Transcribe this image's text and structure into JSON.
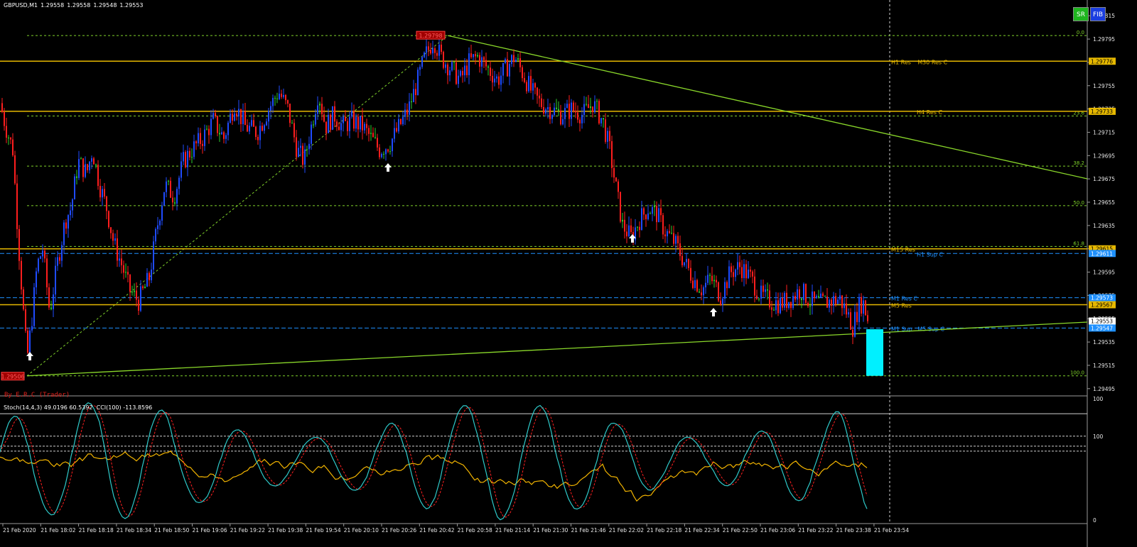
{
  "header": {
    "symbol": "GBPUSD,M1",
    "ohlc": [
      "1.29558",
      "1.29558",
      "1.29548",
      "1.29553"
    ]
  },
  "buttons": {
    "sr": "SR",
    "fib": "FIB"
  },
  "credit": "By E.R.C (Trader)",
  "indicator_label": "Stoch(14,4,3) 49.0196 60.5392  CCI(100) -113.8596",
  "colors": {
    "background": "#000000",
    "bull_candle": "#1f4bff",
    "bear_candle": "#ff1e1e",
    "neutral_candle": "#2ecc2e",
    "resistance": "#e6b800",
    "support": "#1e90ff",
    "fib": "#7fd22a",
    "trendline": "#8ad82a",
    "stoch_main": "#2ec9c9",
    "stoch_signal": "#ff2020",
    "cci": "#f2b400",
    "target_box": "#00f0ff"
  },
  "price_scale": [
    "1.29815",
    "1.29795",
    "1.29775",
    "1.29755",
    "1.29735",
    "1.29715",
    "1.29695",
    "1.29675",
    "1.29655",
    "1.29635",
    "1.29615",
    "1.29595",
    "1.29575",
    "1.29555",
    "1.29535",
    "1.29515",
    "1.29495"
  ],
  "price_tags": [
    {
      "price": 1.29776,
      "text": "1.29776",
      "color": "#e6b800",
      "text_color": "#000"
    },
    {
      "price": 1.29733,
      "text": "1.29733",
      "color": "#e6b800",
      "text_color": "#000"
    },
    {
      "price": 1.29615,
      "text": "1.29615",
      "color": "#e6b800",
      "text_color": "#000"
    },
    {
      "price": 1.29611,
      "text": "1.29611",
      "color": "#1e90ff",
      "text_color": "#fff"
    },
    {
      "price": 1.29573,
      "text": "1.29573",
      "color": "#1e90ff",
      "text_color": "#fff"
    },
    {
      "price": 1.29567,
      "text": "1.29567",
      "color": "#e6b800",
      "text_color": "#000"
    },
    {
      "price": 1.29553,
      "text": "1.29553",
      "color": "#ffffff",
      "text_color": "#000"
    },
    {
      "price": 1.29547,
      "text": "1.29547",
      "color": "#1e90ff",
      "text_color": "#fff"
    }
  ],
  "fib_levels": [
    {
      "price": 1.29798,
      "label": "0.0"
    },
    {
      "price": 1.29729,
      "label": "23.6"
    },
    {
      "price": 1.29686,
      "label": "38.2"
    },
    {
      "price": 1.29652,
      "label": "50.0"
    },
    {
      "price": 1.29617,
      "label": "61.8"
    },
    {
      "price": 1.29506,
      "label": "100.0"
    }
  ],
  "sr_lines": [
    {
      "price": 1.29776,
      "type": "res",
      "labels": [
        "H1 Res",
        "M30 Res C"
      ]
    },
    {
      "price": 1.29733,
      "type": "res",
      "labels": [
        "H4 Res C"
      ]
    },
    {
      "price": 1.29615,
      "type": "res",
      "labels": [
        "M15 Res"
      ]
    },
    {
      "price": 1.29611,
      "type": "sup",
      "labels": [
        "H1 Sup C"
      ]
    },
    {
      "price": 1.29573,
      "type": "sup",
      "labels": [
        "M1 Res C"
      ]
    },
    {
      "price": 1.29567,
      "type": "res",
      "labels": [
        "M5 Res"
      ]
    },
    {
      "price": 1.29547,
      "type": "sup",
      "labels": [
        "M1 Sup",
        "M5 Sup C"
      ]
    }
  ],
  "swing_labels": {
    "high": "1.29798",
    "low": "1.29506"
  },
  "arrow_icons": [
    "up-arrow-icon",
    "up-arrow-icon",
    "up-arrow-icon",
    "up-arrow-icon"
  ],
  "indicator_scale": [
    "100",
    "100",
    "0"
  ],
  "time_labels": [
    "21 Feb 2020",
    "21 Feb 18:02",
    "21 Feb 18:18",
    "21 Feb 18:34",
    "21 Feb 18:50",
    "21 Feb 19:06",
    "21 Feb 19:22",
    "21 Feb 19:38",
    "21 Feb 19:54",
    "21 Feb 20:10",
    "21 Feb 20:26",
    "21 Feb 20:42",
    "21 Feb 20:58",
    "21 Feb 21:14",
    "21 Feb 21:30",
    "21 Feb 21:46",
    "21 Feb 22:02",
    "21 Feb 22:18",
    "21 Feb 22:34",
    "21 Feb 22:50",
    "21 Feb 23:06",
    "21 Feb 23:22",
    "21 Feb 23:38",
    "21 Feb 23:54"
  ],
  "chart_data": {
    "type": "candlestick",
    "symbol": "GBPUSD",
    "timeframe": "M1",
    "ylim": [
      1.29495,
      1.2982
    ],
    "price_path": [
      [
        0,
        1.2974
      ],
      [
        8,
        1.2972
      ],
      [
        18,
        1.297
      ],
      [
        26,
        1.2962
      ],
      [
        33,
        1.2956
      ],
      [
        38,
        1.2952
      ],
      [
        44,
        1.2955
      ],
      [
        52,
        1.296
      ],
      [
        60,
        1.29615
      ],
      [
        70,
        1.2956
      ],
      [
        80,
        1.296
      ],
      [
        92,
        1.2964
      ],
      [
        100,
        1.2965
      ],
      [
        110,
        1.2969
      ],
      [
        122,
        1.2968
      ],
      [
        130,
        1.297
      ],
      [
        140,
        1.2967
      ],
      [
        150,
        1.2965
      ],
      [
        160,
        1.2962
      ],
      [
        172,
        1.296
      ],
      [
        182,
        1.2958
      ],
      [
        195,
        1.2957
      ],
      [
        210,
        1.2959
      ],
      [
        220,
        1.2963
      ],
      [
        232,
        1.2967
      ],
      [
        245,
        1.2966
      ],
      [
        258,
        1.2969
      ],
      [
        270,
        1.297
      ],
      [
        285,
        1.2971
      ],
      [
        300,
        1.29725
      ],
      [
        315,
        1.2971
      ],
      [
        330,
        1.2974
      ],
      [
        345,
        1.2972
      ],
      [
        362,
        1.29715
      ],
      [
        378,
        1.29735
      ],
      [
        392,
        1.2975
      ],
      [
        405,
        1.29735
      ],
      [
        418,
        1.297
      ],
      [
        428,
        1.2969
      ],
      [
        438,
        1.2972
      ],
      [
        448,
        1.2975
      ],
      [
        458,
        1.2972
      ],
      [
        470,
        1.2973
      ],
      [
        482,
        1.2972
      ],
      [
        495,
        1.29725
      ],
      [
        510,
        1.2972
      ],
      [
        522,
        1.2971
      ],
      [
        534,
        1.297
      ],
      [
        548,
        1.29705
      ],
      [
        562,
        1.2972
      ],
      [
        575,
        1.29735
      ],
      [
        588,
        1.2976
      ],
      [
        598,
        1.2978
      ],
      [
        610,
        1.29795
      ],
      [
        620,
        1.2978
      ],
      [
        634,
        1.2977
      ],
      [
        648,
        1.2976
      ],
      [
        660,
        1.29775
      ],
      [
        672,
        1.2978
      ],
      [
        686,
        1.2977
      ],
      [
        700,
        1.2976
      ],
      [
        712,
        1.2977
      ],
      [
        724,
        1.2978
      ],
      [
        736,
        1.29765
      ],
      [
        748,
        1.2975
      ],
      [
        760,
        1.2974
      ],
      [
        775,
        1.29735
      ],
      [
        790,
        1.2973
      ],
      [
        805,
        1.29735
      ],
      [
        820,
        1.2973
      ],
      [
        834,
        1.2974
      ],
      [
        848,
        1.29725
      ],
      [
        858,
        1.297
      ],
      [
        866,
        1.2967
      ],
      [
        876,
        1.29635
      ],
      [
        888,
        1.29625
      ],
      [
        900,
        1.2964
      ],
      [
        912,
        1.2965
      ],
      [
        924,
        1.29645
      ],
      [
        936,
        1.2963
      ],
      [
        950,
        1.2962
      ],
      [
        962,
        1.29605
      ],
      [
        975,
        1.2959
      ],
      [
        988,
        1.2958
      ],
      [
        1000,
        1.2959
      ],
      [
        1014,
        1.29575
      ],
      [
        1028,
        1.29595
      ],
      [
        1042,
        1.296
      ],
      [
        1056,
        1.2959
      ],
      [
        1070,
        1.29575
      ],
      [
        1084,
        1.2957
      ],
      [
        1098,
        1.29568
      ],
      [
        1112,
        1.29572
      ],
      [
        1126,
        1.2958
      ],
      [
        1140,
        1.2957
      ],
      [
        1154,
        1.29568
      ],
      [
        1168,
        1.2957
      ],
      [
        1182,
        1.29572
      ],
      [
        1192,
        1.2956
      ],
      [
        1200,
        1.29548
      ],
      [
        1208,
        1.29565
      ],
      [
        1214,
        1.2957
      ],
      [
        1222,
        1.29553
      ]
    ]
  }
}
